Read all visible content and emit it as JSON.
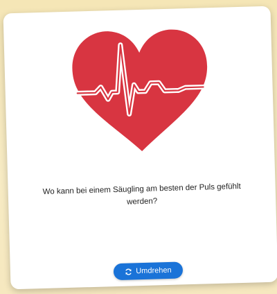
{
  "card": {
    "question": "Wo kann bei einem Säugling am besten der Puls gefühlt werden?",
    "image": "heart-with-ecg-line"
  },
  "flip_button": {
    "label": "Umdrehen",
    "icon": "refresh-icon"
  },
  "colors": {
    "heart": "#d83541",
    "button": "#1a73d8",
    "background": "#f6e9bd"
  }
}
